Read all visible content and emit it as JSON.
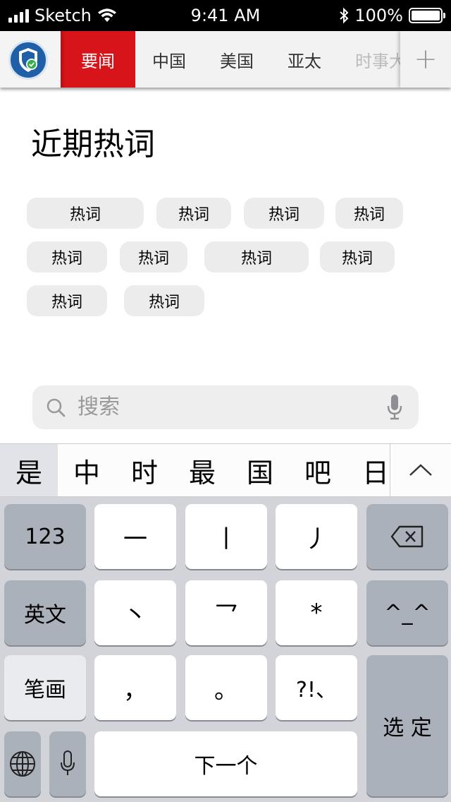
{
  "status_bar": {
    "carrier": "Sketch",
    "time": "9:41 AM",
    "battery_percent": "100%",
    "battery_level": 1.0
  },
  "nav": {
    "tabs": [
      "要闻",
      "中国",
      "美国",
      "亚太",
      "时事大"
    ],
    "active_tab": 0,
    "add_label": "+",
    "accent_color": "#d7141a"
  },
  "hot_words": {
    "title": "近期热词",
    "chips": [
      "热词",
      "热词",
      "热词",
      "热词",
      "热词",
      "热词",
      "热词",
      "热词",
      "热词",
      "热词"
    ]
  },
  "search": {
    "placeholder": "搜索"
  },
  "candidates": {
    "items": [
      "是",
      "中",
      "时",
      "最",
      "国",
      "吧",
      "日"
    ]
  },
  "keyboard": {
    "row1": [
      "123",
      "一",
      "丨",
      "丿"
    ],
    "row2": [
      "英文",
      "丶",
      "乛",
      "*",
      "^_^"
    ],
    "row3": [
      "笔画",
      "，",
      "。",
      "?!、"
    ],
    "row4": [
      "下一个"
    ],
    "select_label": "选 定"
  }
}
